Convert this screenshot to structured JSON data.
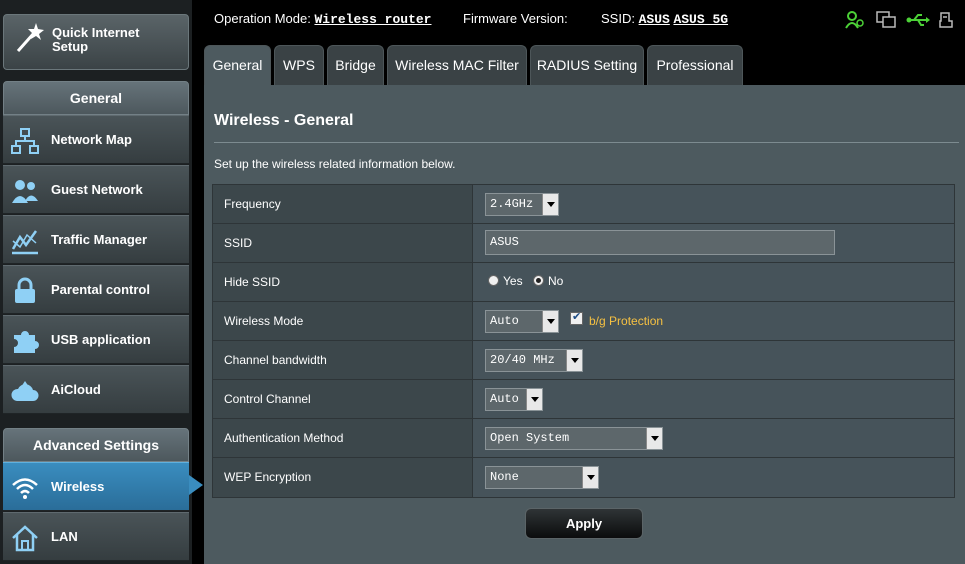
{
  "header": {
    "operation_mode_label": "Operation Mode:",
    "operation_mode_value": "Wireless router",
    "firmware_label": "Firmware Version:",
    "ssid_label": "SSID:",
    "ssid_1": "ASUS",
    "ssid_2": "ASUS_5G",
    "status_icons": [
      "users-icon",
      "devices-icon",
      "usb-icon",
      "printer-icon"
    ]
  },
  "sidebar": {
    "quick_setup": "Quick Internet Setup",
    "general_heading": "General",
    "general_items": [
      {
        "label": "Network Map",
        "icon": "network-map-icon"
      },
      {
        "label": "Guest Network",
        "icon": "guest-network-icon"
      },
      {
        "label": "Traffic Manager",
        "icon": "traffic-manager-icon"
      },
      {
        "label": "Parental control",
        "icon": "lock-icon"
      },
      {
        "label": "USB application",
        "icon": "puzzle-icon"
      },
      {
        "label": "AiCloud",
        "icon": "cloud-icon"
      }
    ],
    "advanced_heading": "Advanced Settings",
    "advanced_items": [
      {
        "label": "Wireless",
        "icon": "wifi-icon",
        "active": true
      },
      {
        "label": "LAN",
        "icon": "home-icon",
        "active": false
      }
    ]
  },
  "tabs": [
    {
      "label": "General",
      "active": true
    },
    {
      "label": "WPS",
      "active": false
    },
    {
      "label": "Bridge",
      "active": false
    },
    {
      "label": "Wireless MAC Filter",
      "active": false
    },
    {
      "label": "RADIUS Setting",
      "active": false
    },
    {
      "label": "Professional",
      "active": false
    }
  ],
  "main": {
    "title": "Wireless - General",
    "description": "Set up the wireless related information below.",
    "fields": {
      "frequency": {
        "label": "Frequency",
        "value": "2.4GHz"
      },
      "ssid": {
        "label": "SSID",
        "value": "ASUS"
      },
      "hide_ssid": {
        "label": "Hide SSID",
        "yes": "Yes",
        "no": "No",
        "selected": "No"
      },
      "wireless_mode": {
        "label": "Wireless Mode",
        "value": "Auto",
        "protection_label": "b/g Protection",
        "protection_checked": true
      },
      "channel_bandwidth": {
        "label": "Channel bandwidth",
        "value": "20/40 MHz"
      },
      "control_channel": {
        "label": "Control Channel",
        "value": "Auto"
      },
      "auth_method": {
        "label": "Authentication Method",
        "value": "Open System"
      },
      "wep_encryption": {
        "label": "WEP Encryption",
        "value": "None"
      }
    },
    "apply_label": "Apply"
  },
  "colors": {
    "active_nav": "#3a8dbf",
    "status_green": "#4cd137",
    "protection_text": "#f6c142"
  }
}
